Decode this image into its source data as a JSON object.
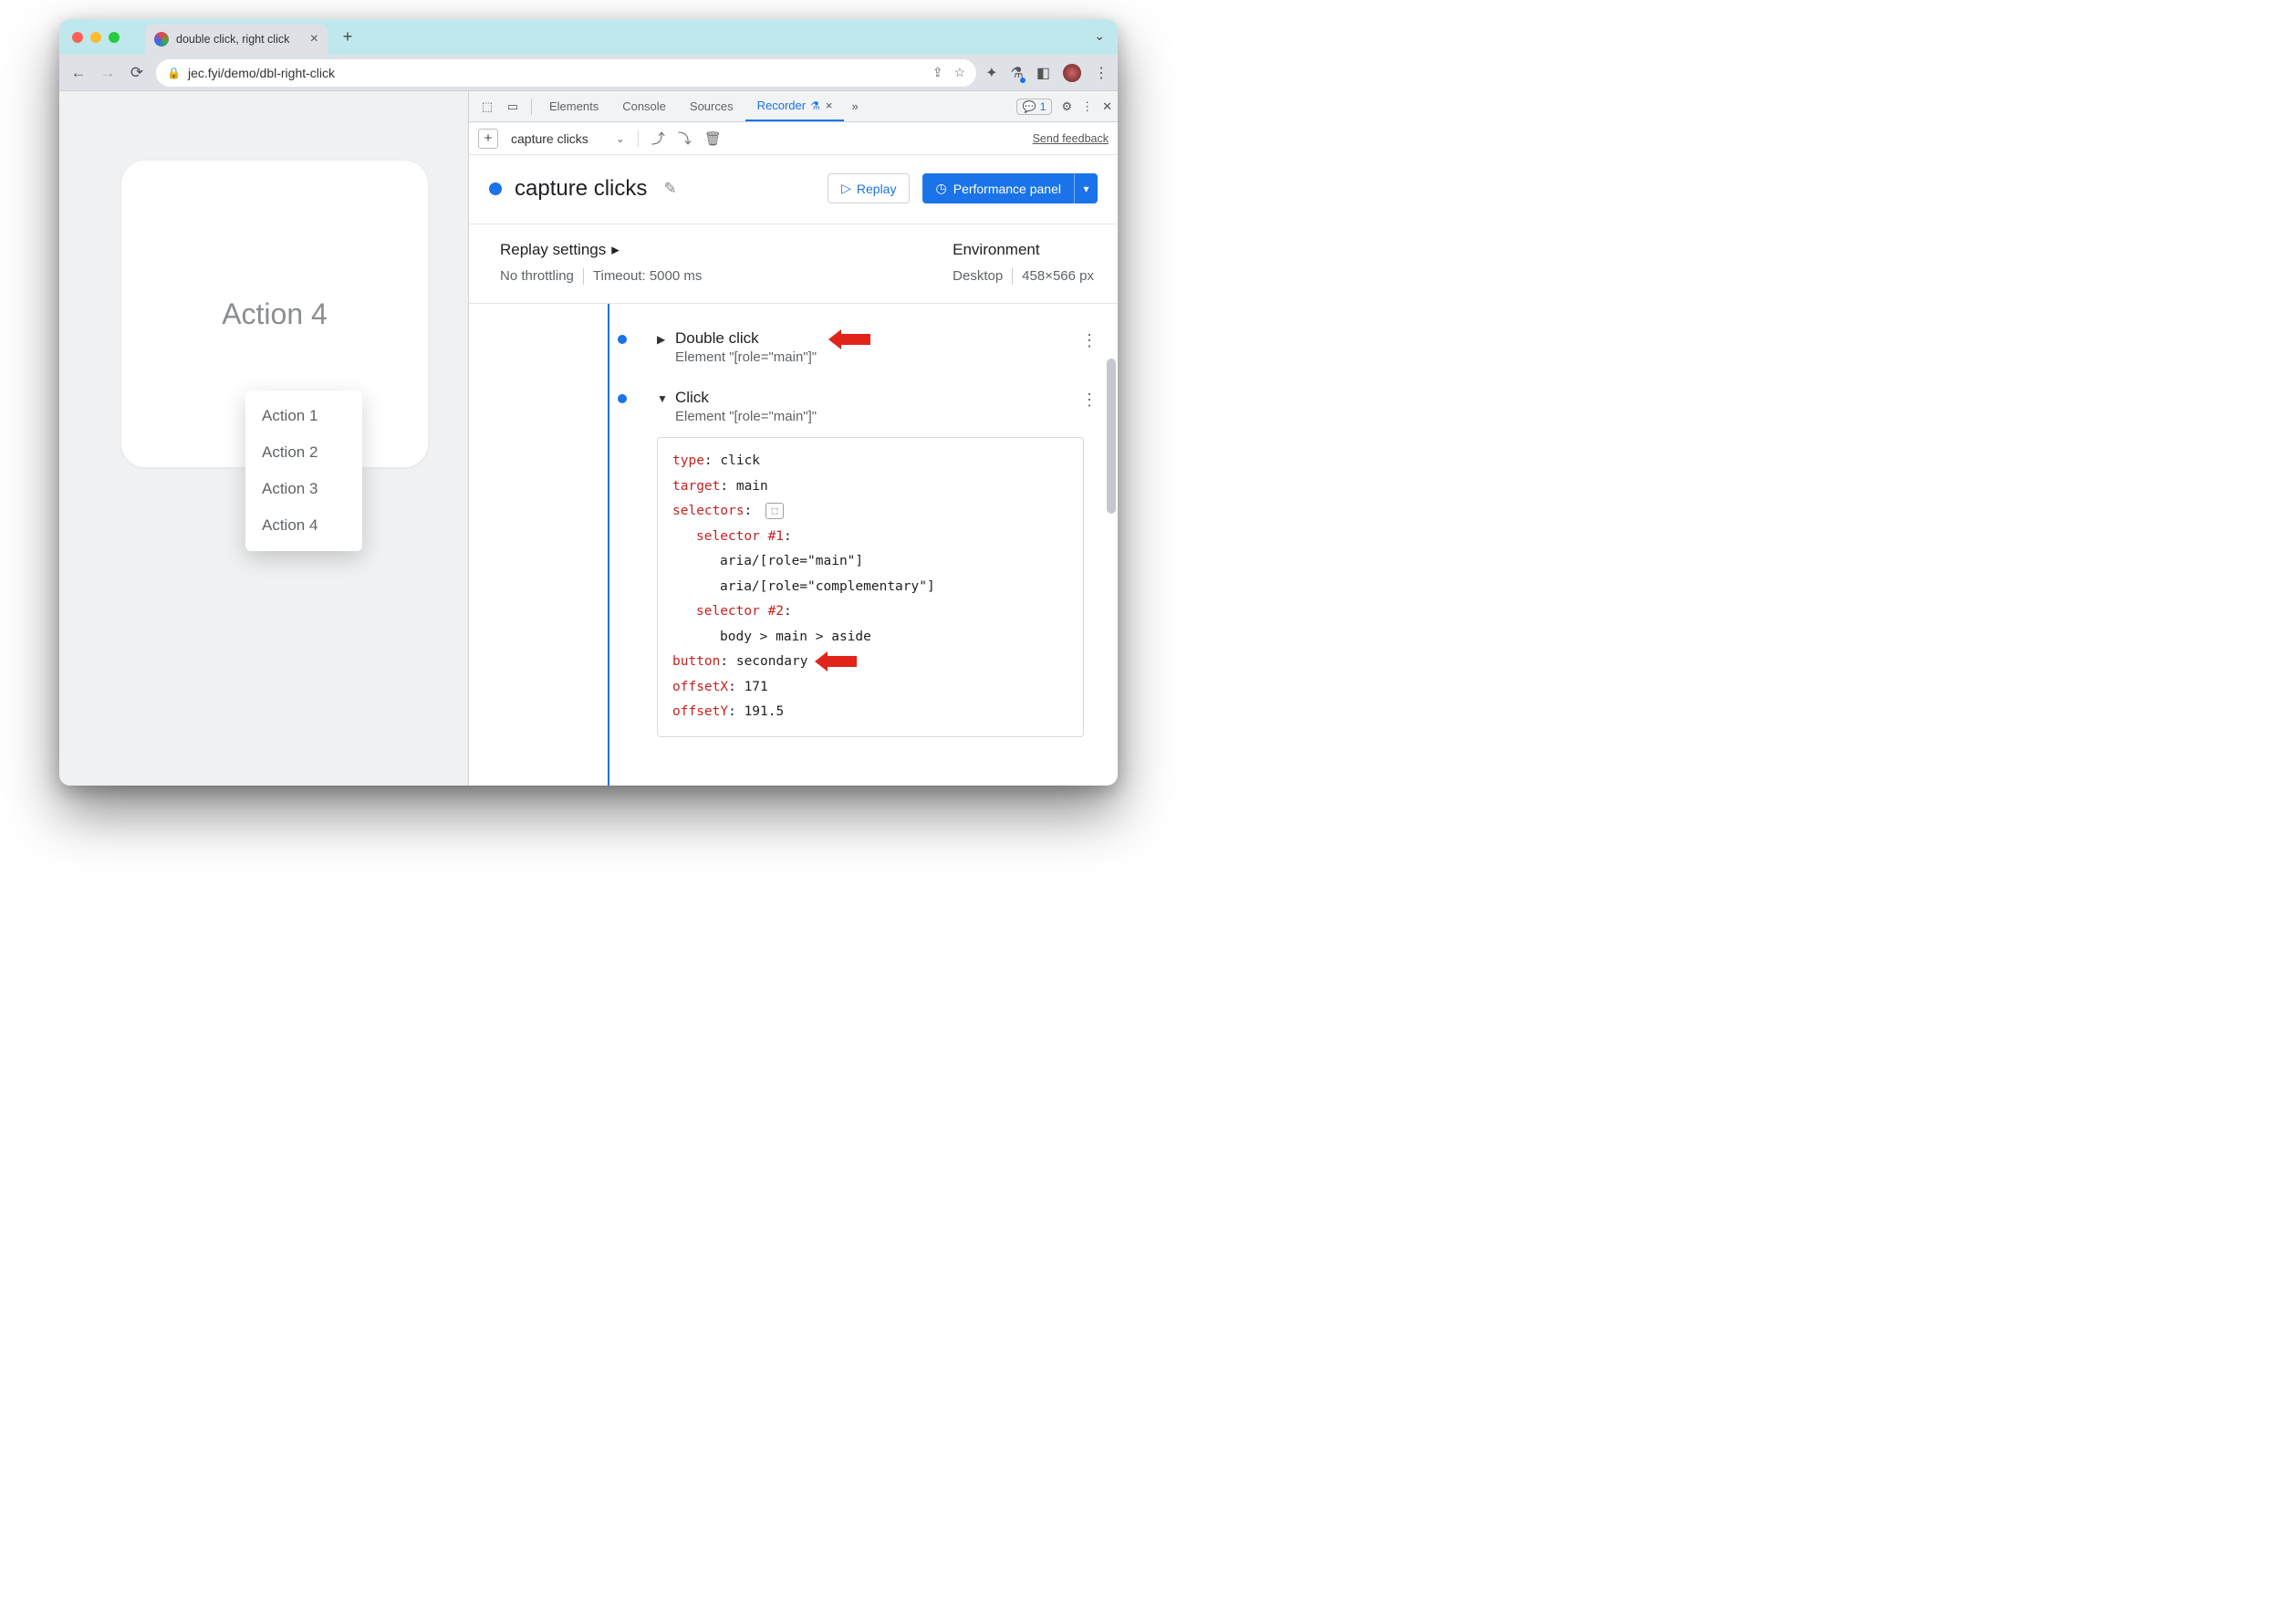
{
  "tab": {
    "title": "double click, right click"
  },
  "url": {
    "host_path": "jec.fyi/demo/dbl-right-click"
  },
  "devtools": {
    "tabs": {
      "elements": "Elements",
      "console": "Console",
      "sources": "Sources",
      "recorder": "Recorder"
    },
    "issues_count": "1",
    "recorder": {
      "toolbar": {
        "recording_name": "capture clicks",
        "feedback": "Send feedback"
      },
      "header": {
        "title": "capture clicks",
        "replay": "Replay",
        "perf_panel": "Performance panel"
      },
      "settings": {
        "title": "Replay settings",
        "throttling": "No throttling",
        "timeout": "Timeout: 5000 ms",
        "env_title": "Environment",
        "env_device": "Desktop",
        "env_dims": "458×566 px"
      },
      "steps": {
        "s1": {
          "title": "Double click",
          "sub": "Element \"[role=\"main\"]\""
        },
        "s2": {
          "title": "Click",
          "sub": "Element \"[role=\"main\"]\"",
          "details": {
            "type_k": "type",
            "type_v": "click",
            "target_k": "target",
            "target_v": "main",
            "selectors_k": "selectors",
            "sel1_k": "selector #1",
            "sel1_a": "aria/[role=\"main\"]",
            "sel1_b": "aria/[role=\"complementary\"]",
            "sel2_k": "selector #2",
            "sel2_a": "body > main > aside",
            "button_k": "button",
            "button_v": "secondary",
            "offx_k": "offsetX",
            "offx_v": "171",
            "offy_k": "offsetY",
            "offy_v": "191.5"
          }
        }
      }
    }
  },
  "page": {
    "card_label": "Action 4",
    "menu": {
      "a1": "Action 1",
      "a2": "Action 2",
      "a3": "Action 3",
      "a4": "Action 4"
    }
  }
}
